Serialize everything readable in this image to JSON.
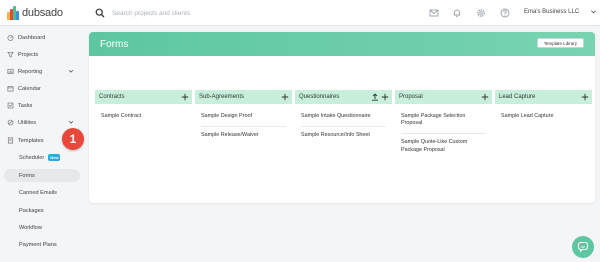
{
  "header": {
    "logo_text": "dubsado",
    "search_placeholder": "Search projects and clients",
    "account_name": "Ema's Business LLC",
    "icons": [
      "mail-icon",
      "bell-icon",
      "gear-icon",
      "help-icon"
    ]
  },
  "sidebar": {
    "items": [
      {
        "label": "Dashboard",
        "icon": "dashboard-icon"
      },
      {
        "label": "Projects",
        "icon": "projects-icon"
      },
      {
        "label": "Reporting",
        "icon": "reporting-icon"
      },
      {
        "label": "Calendar",
        "icon": "calendar-icon"
      },
      {
        "label": "Tasks",
        "icon": "tasks-icon"
      },
      {
        "label": "Utilities",
        "icon": "utilities-icon"
      },
      {
        "label": "Templates",
        "icon": "templates-icon"
      }
    ],
    "sub_items": [
      {
        "label": "Scheduler",
        "badge": "New"
      },
      {
        "label": "Forms"
      },
      {
        "label": "Canned Emails"
      },
      {
        "label": "Packages"
      },
      {
        "label": "Workflow"
      },
      {
        "label": "Payment Plans"
      }
    ],
    "step_badge": "1"
  },
  "main": {
    "title": "Forms",
    "template_library_label": "Template Library",
    "columns": [
      {
        "title": "Contracts",
        "items": [
          "Sample Contract"
        ]
      },
      {
        "title": "Sub-Agreements",
        "items": [
          "Sample Design Proof",
          "Sample Release/Waiver"
        ]
      },
      {
        "title": "Questionnaires",
        "items": [
          "Sample Intake Questionnaire",
          "Sample Resource/Info Sheet"
        ]
      },
      {
        "title": "Proposal",
        "items": [
          "Sample Package Selection Proposal",
          "Sample Quote-Like Custom Package Proposal"
        ]
      },
      {
        "title": "Lead Capture",
        "items": [
          "Sample Lead Capture"
        ]
      }
    ]
  },
  "colors": {
    "accent": "#5cc7a0",
    "column_header": "#c7efdb",
    "badge_red": "#e8473b",
    "new_badge": "#2ea8e0"
  }
}
